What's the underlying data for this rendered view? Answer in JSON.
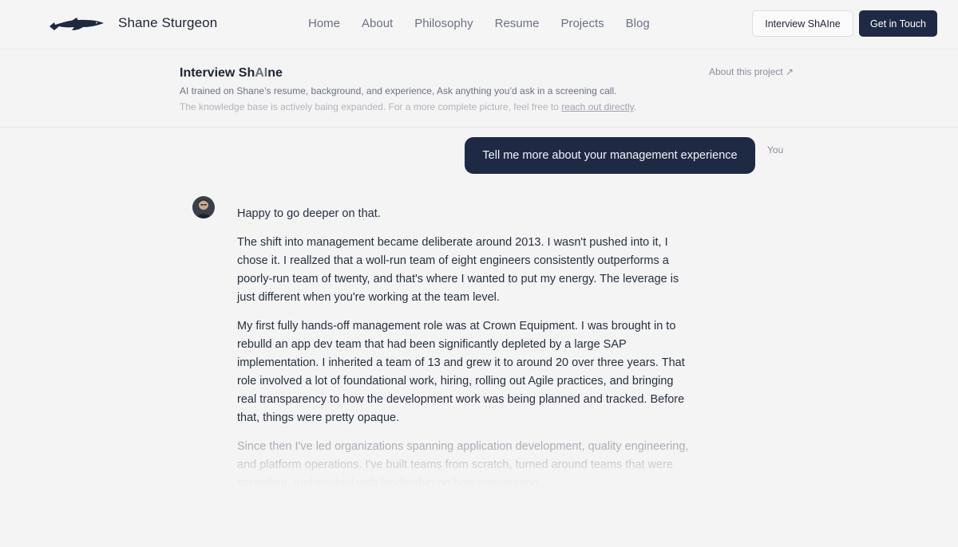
{
  "nav": {
    "brand_name": "Shane Sturgeon",
    "links": [
      "Home",
      "About",
      "Philosophy",
      "Resume",
      "Projects",
      "Blog"
    ],
    "interview_button": "Interview ShAIne",
    "contact_button": "Get in Touch",
    "logo_icon": "sturgeon-fish-icon"
  },
  "header": {
    "title_prefix": "Interview Sh",
    "title_highlight": "AI",
    "title_suffix": "ne",
    "about_link": "About this project ↗",
    "subtitle": "AI trained on Shane’s resume, background, and experience, Ask anything you’d ask in a screening call.",
    "note_text": "The knowledge base is actively baing expanded. For a more complete picture, feel free to",
    "note_link": "reach out directly",
    "note_end": "."
  },
  "chat": {
    "user_message": "Tell me more about your management experience",
    "user_label": "You",
    "assistant_paragraphs": [
      "Happy to go deeper on that.",
      "The shift into management became deliberate around 2013. I wasn't pushed into it, I chose it. I reallzed that a woll-run team of eight engineers consistently outperforms a poorly-run team of twenty, and that's where I wanted to put my energy. The leverage is just different when you're working at the team level.",
      "My first fully hands-off management role was at Crown Equipment. I was brought in to rebulld an app dev team that had been significantly depleted by a large SAP implementation. I inherited a team of 13 and grew it to around 20 over three years. That role involved a lot of foundational work, hiring, rolling out Agile practices, and bringing real transparency to how the development work was being planned and tracked. Before that, things were pretty opaque.",
      "Since then I've led organizations spanning application development, quality engineering, and platform operations. I've built teams from scratch, turned around teams that were struggling, and worked with leadership on how engineering"
    ]
  },
  "colors": {
    "primary_dark": "#1e2a44",
    "background": "#f4f4f5"
  }
}
